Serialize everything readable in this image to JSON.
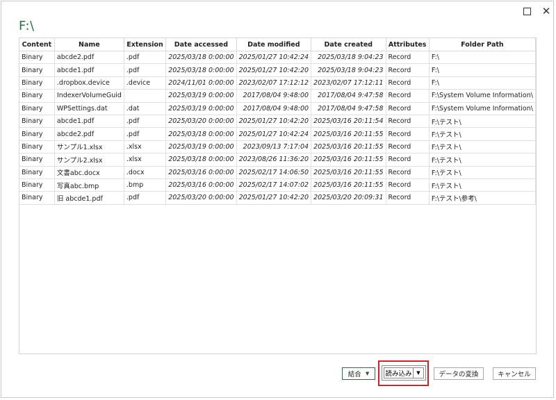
{
  "window": {
    "title": "F:\\",
    "maximize_icon": "maximize-icon",
    "close_icon": "close-icon"
  },
  "table": {
    "columns": [
      "Content",
      "Name",
      "Extension",
      "Date accessed",
      "Date modified",
      "Date created",
      "Attributes",
      "Folder Path"
    ],
    "rows": [
      [
        "Binary",
        "abcde2.pdf",
        ".pdf",
        "2025/03/18 0:00:00",
        "2025/01/27 10:42:24",
        "2025/03/18 9:04:23",
        "Record",
        "F:\\"
      ],
      [
        "Binary",
        "abcde1.pdf",
        ".pdf",
        "2025/03/18 0:00:00",
        "2025/01/27 10:42:20",
        "2025/03/18 9:04:23",
        "Record",
        "F:\\"
      ],
      [
        "Binary",
        ".dropbox.device",
        ".device",
        "2024/11/01 0:00:00",
        "2023/02/07 17:12:12",
        "2023/02/07 17:12:11",
        "Record",
        "F:\\"
      ],
      [
        "Binary",
        "IndexerVolumeGuid",
        "",
        "2025/03/19 0:00:00",
        "2017/08/04 9:48:00",
        "2017/08/04 9:47:58",
        "Record",
        "F:\\System Volume Information\\"
      ],
      [
        "Binary",
        "WPSettings.dat",
        ".dat",
        "2025/03/19 0:00:00",
        "2017/08/04 9:48:00",
        "2017/08/04 9:47:58",
        "Record",
        "F:\\System Volume Information\\"
      ],
      [
        "Binary",
        "abcde1.pdf",
        ".pdf",
        "2025/03/20 0:00:00",
        "2025/01/27 10:42:20",
        "2025/03/16 20:11:54",
        "Record",
        "F:\\テスト\\"
      ],
      [
        "Binary",
        "abcde2.pdf",
        ".pdf",
        "2025/03/18 0:00:00",
        "2025/01/27 10:42:24",
        "2025/03/16 20:11:55",
        "Record",
        "F:\\テスト\\"
      ],
      [
        "Binary",
        "サンプル1.xlsx",
        ".xlsx",
        "2025/03/19 0:00:00",
        "2023/09/13 7:17:04",
        "2025/03/16 20:11:55",
        "Record",
        "F:\\テスト\\"
      ],
      [
        "Binary",
        "サンプル2.xlsx",
        ".xlsx",
        "2025/03/18 0:00:00",
        "2023/08/26 11:36:20",
        "2025/03/16 20:11:55",
        "Record",
        "F:\\テスト\\"
      ],
      [
        "Binary",
        "文書abc.docx",
        ".docx",
        "2025/03/16 0:00:00",
        "2025/02/17 14:06:50",
        "2025/03/16 20:11:55",
        "Record",
        "F:\\テスト\\"
      ],
      [
        "Binary",
        "写真abc.bmp",
        ".bmp",
        "2025/03/16 0:00:00",
        "2025/02/17 14:07:02",
        "2025/03/16 20:11:55",
        "Record",
        "F:\\テスト\\"
      ],
      [
        "Binary",
        "旧 abcde1.pdf",
        ".pdf",
        "2025/03/20 0:00:00",
        "2025/01/27 10:42:20",
        "2025/03/20 20:09:31",
        "Record",
        "F:\\テスト\\参考\\"
      ]
    ]
  },
  "buttons": {
    "combine": "結合",
    "load": "読み込み",
    "transform": "データの変換",
    "cancel": "キャンセル"
  },
  "colors": {
    "accent": "#217346",
    "highlight": "#d21f2b"
  }
}
